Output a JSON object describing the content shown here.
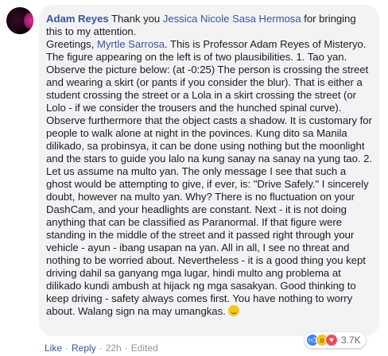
{
  "comment": {
    "author": "Adam Reyes",
    "text_1": " Thank you ",
    "mention_1": "Jessica Nicole Sasa Hermosa",
    "text_2": " for bringing this to my attention.",
    "text_3": "Greetings, ",
    "mention_2": "Myrtle Sarrosa",
    "text_4": ". This is Professor Adam Reyes of Misteryo. The figure appearing on the left is of two plausibilities. 1. Tao yan. Observe the picture below: (at -0:25) The person is crossing the street and wearing a skirt (or pants if you consider the blur). That is either a student crossing the street or a Lola in a skirt crossing the street (or Lolo - if we consider the trousers and the hunched spinal curve). Observe furthermore that the object casts a shadow. It is customary for people to walk alone at night in the povinces. Kung dito sa Manila dilikado, sa probinsya, it can be done using nothing but the moonlight and the stars to guide you lalo na kung sanay na sanay na yung tao. 2. Let us assume na multo yan. The only message I see that such a ghost would be attempting to give, if ever, is: \"Drive Safely.\" I sincerely doubt, however na multo yan. Why? There is no fluctuation on your DashCam, and your headlights are constant. Next - it is not doing anything that can be classified as Paranormal. If that figure were standing in the middle of the street and it passed right through your vehicle - ayun - ibang usapan na yan. All in all, I see no threat and nothing to be worried about. Nevertheless - it is a good thing you kept driving dahil sa ganyang mga lugar, hindi multo ang problema at dilikado kundi ambush at hijack ng mga sasakyan. Good thinking to keep driving - safety always comes first. You have nothing to worry about. Walang sign na may umangkas. ",
    "emoji_icon": "smiley-icon"
  },
  "reactions": {
    "icons": [
      "like-icon",
      "wow-icon",
      "love-icon"
    ],
    "count": "3.7K"
  },
  "actions": {
    "like": "Like",
    "reply": "Reply",
    "time": "22h",
    "edited": "Edited",
    "sep": "·"
  }
}
